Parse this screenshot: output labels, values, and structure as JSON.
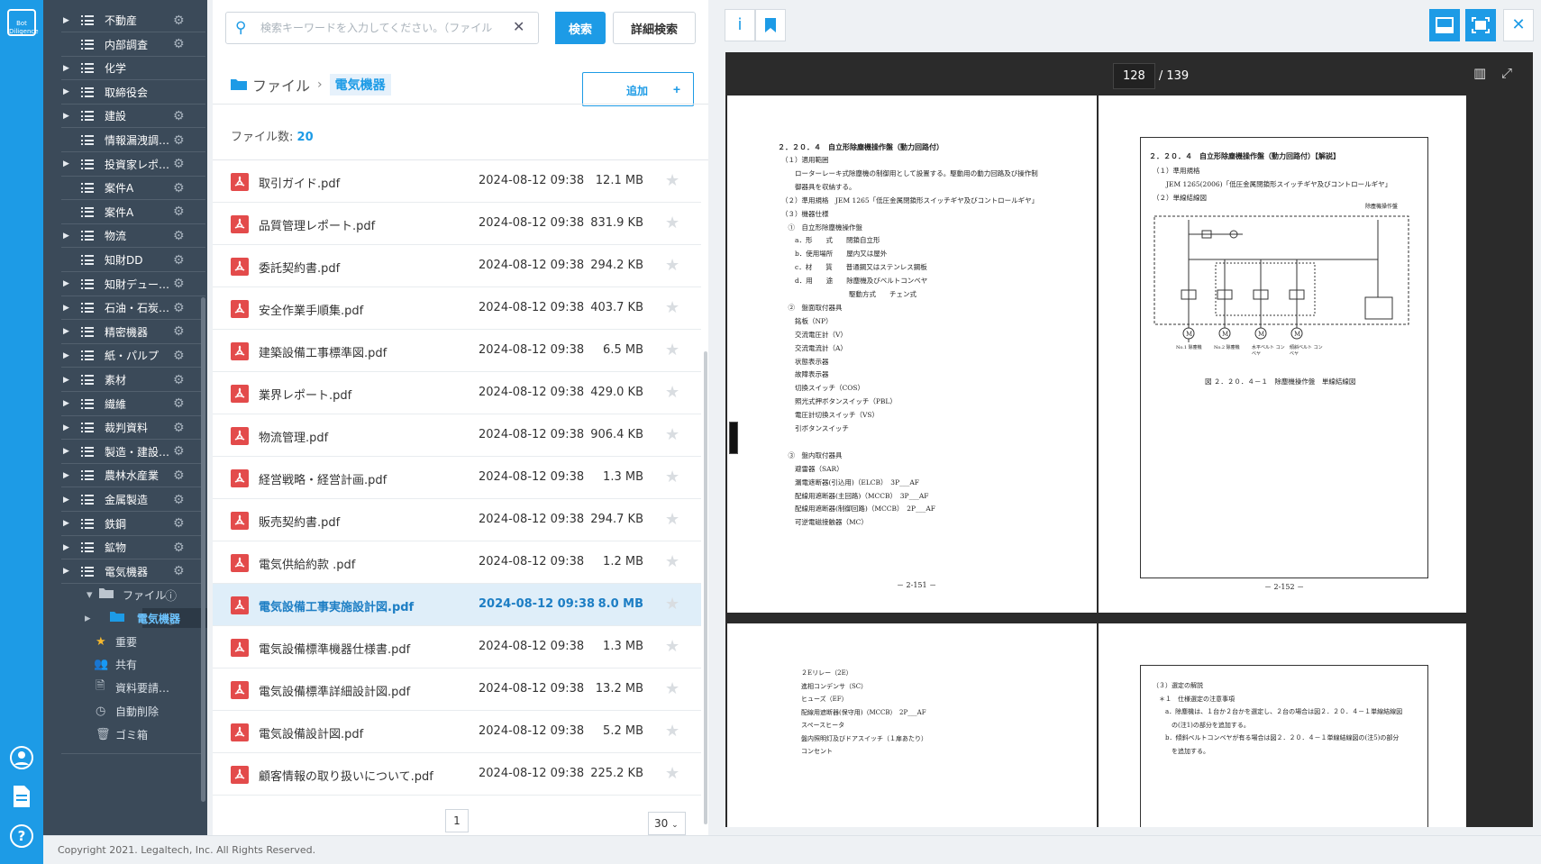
{
  "rail": {
    "logo_text": "Bot Diligence"
  },
  "sidebar": {
    "items": [
      {
        "label": "不動産",
        "caret": true,
        "gear": true
      },
      {
        "label": "内部調査",
        "caret": false,
        "gear": true
      },
      {
        "label": "化学",
        "caret": true,
        "gear": false
      },
      {
        "label": "取締役会",
        "caret": true,
        "gear": false
      },
      {
        "label": "建設",
        "caret": true,
        "gear": true
      },
      {
        "label": "情報漏洩調…",
        "caret": false,
        "gear": true
      },
      {
        "label": "投資家レポ…",
        "caret": true,
        "gear": true
      },
      {
        "label": "案件A",
        "caret": false,
        "gear": true
      },
      {
        "label": "案件A",
        "caret": false,
        "gear": true
      },
      {
        "label": "物流",
        "caret": true,
        "gear": true
      },
      {
        "label": "知財DD",
        "caret": false,
        "gear": true
      },
      {
        "label": "知財デュー…",
        "caret": true,
        "gear": true
      },
      {
        "label": "石油・石炭…",
        "caret": true,
        "gear": true
      },
      {
        "label": "精密機器",
        "caret": true,
        "gear": true
      },
      {
        "label": "紙・パルプ",
        "caret": true,
        "gear": true
      },
      {
        "label": "素材",
        "caret": true,
        "gear": true
      },
      {
        "label": "繊維",
        "caret": true,
        "gear": true
      },
      {
        "label": "裁判資料",
        "caret": true,
        "gear": true
      },
      {
        "label": "製造・建設…",
        "caret": true,
        "gear": true
      },
      {
        "label": "農林水産業",
        "caret": true,
        "gear": true
      },
      {
        "label": "金属製造",
        "caret": true,
        "gear": true
      },
      {
        "label": "鉄鋼",
        "caret": true,
        "gear": true
      },
      {
        "label": "鉱物",
        "caret": true,
        "gear": true
      },
      {
        "label": "電気機器",
        "caret": true,
        "gear": true
      }
    ],
    "sub": {
      "files": "ファイル",
      "current": "電気機器",
      "important": "重要",
      "shared": "共有",
      "request": "資料要請…",
      "auto_delete": "自動削除",
      "trash": "ゴミ箱"
    }
  },
  "search": {
    "placeholder": "検索キーワードを入力してください。（ファイル",
    "button": "検索",
    "advanced": "詳細検索"
  },
  "breadcrumb": {
    "root": "ファイル",
    "current": "電気機器"
  },
  "add_label": "追加",
  "file_count_label": "ファイル数:",
  "file_count": "20",
  "files": [
    {
      "name": "取引ガイド.pdf",
      "date": "2024-08-12 09:38",
      "size": "12.1 MB"
    },
    {
      "name": "品質管理レポート.pdf",
      "date": "2024-08-12 09:38",
      "size": "831.9 KB"
    },
    {
      "name": "委託契約書.pdf",
      "date": "2024-08-12 09:38",
      "size": "294.2 KB"
    },
    {
      "name": "安全作業手順集.pdf",
      "date": "2024-08-12 09:38",
      "size": "403.7 KB"
    },
    {
      "name": "建築設備工事標準図.pdf",
      "date": "2024-08-12 09:38",
      "size": "6.5 MB"
    },
    {
      "name": "業界レポート.pdf",
      "date": "2024-08-12 09:38",
      "size": "429.0 KB"
    },
    {
      "name": "物流管理.pdf",
      "date": "2024-08-12 09:38",
      "size": "906.4 KB"
    },
    {
      "name": "経営戦略・経営計画.pdf",
      "date": "2024-08-12 09:38",
      "size": "1.3 MB"
    },
    {
      "name": "販売契約書.pdf",
      "date": "2024-08-12 09:38",
      "size": "294.7 KB"
    },
    {
      "name": "電気供給約款 .pdf",
      "date": "2024-08-12 09:38",
      "size": "1.2 MB"
    },
    {
      "name": "電気設備工事実施設計図.pdf",
      "date": "2024-08-12 09:38",
      "size": "8.0 MB"
    },
    {
      "name": "電気設備標準機器仕様書.pdf",
      "date": "2024-08-12 09:38",
      "size": "1.3 MB"
    },
    {
      "name": "電気設備標準詳細設計図.pdf",
      "date": "2024-08-12 09:38",
      "size": "13.2 MB"
    },
    {
      "name": "電気設備設計図.pdf",
      "date": "2024-08-12 09:38",
      "size": "5.2 MB"
    },
    {
      "name": "顧客情報の取り扱いについて.pdf",
      "date": "2024-08-12 09:38",
      "size": "225.2 KB"
    }
  ],
  "selected_index": 10,
  "pagination": {
    "page": "1",
    "per_page": "30"
  },
  "viewer": {
    "current_page": "128",
    "total_pages": "/ 139",
    "left_page": {
      "heading": "２．２０．４　自立形除塵機操作盤（動力回路付）",
      "lines": [
        "（１）適用範囲",
        "　　ローターレーキ式除塵機の制御用として設置する。駆動用の動力回路及び操作制",
        "　　御器具を収納する。",
        "（２）準用規格　JEM 1265「低圧金属閉鎖形スイッチギヤ及びコントロールギヤ」",
        "（３）機器仕様",
        "　①　自立形除塵機操作盤",
        "　　a．形　　式　　閉鎖自立形",
        "　　b．使用場所　　屋内又は屋外",
        "　　c．材　　質　　普通鋼又はステンレス鋼板",
        "　　d．用　　途　　除塵機及びベルトコンベヤ",
        "　　　　　　　　　　駆動方式　　チェン式",
        "　②　盤面取付器具",
        "　　銘板（NP）",
        "　　交流電圧計（V）",
        "　　交流電流計（A）",
        "　　状態表示器",
        "　　故障表示器",
        "　　切換スイッチ（COS）",
        "　　照光式押ボタンスイッチ（PBL）",
        "　　電圧計切換スイッチ（VS）",
        "　　引ボタンスイッチ",
        "",
        "　③　盤内取付器具",
        "　　避雷器（SAR）",
        "　　漏電遮断器(引込用)（ELCB）　3P___AF",
        "　　配線用遮断器(主回路)（MCCB）　3P___AF",
        "　　配線用遮断器(制御回路)（MCCB）　2P___AF",
        "　　可逆電磁接触器（MC）"
      ],
      "footer": "－ 2-151 －"
    },
    "right_page": {
      "heading": "２．２０．４　自立形除塵機操作盤（動力回路付）【解説】",
      "lines": [
        "（１）準用規格",
        "　　JEM 1265(2006)「低圧金属閉鎖形スイッチギヤ及びコントロールギヤ」",
        "（２）単線結線図"
      ],
      "caption": "図 ２．２０．４－１　除塵機操作盤　単線結線図",
      "footer": "－ 2-152 －",
      "diagram_title": "除塵機操作盤",
      "motor_labels": [
        "No.1 除塵機",
        "No.2 除塵機",
        "水平ベルト コンベヤ",
        "傾斜ベルト コンベヤ"
      ]
    },
    "next_left": {
      "lines": [
        "２Eリレー（2E）",
        "進相コンデンサ（SC）",
        "ヒューズ（EF）",
        "配線用遮断器(保守用)（MCCB）　2P___AF",
        "スペースヒータ",
        "盤内照明灯及びドアスイッチ（１扉あたり）",
        "コンセント"
      ]
    },
    "next_right": {
      "lines": [
        "（３）選定の解説",
        "　＊１　仕様選定の注意事項",
        "　　a．除塵機は、１台か２台かを選定し、２台の場合は図２．２０．４－１単線結線図",
        "　　　の(注1)の部分を追加する。",
        "　　b．傾斜ベルトコンベヤが有る場合は図２．２０．４－１単線結線図の(注5)の部分",
        "　　　を追加する。"
      ]
    }
  },
  "footer": "Copyright 2021. Legaltech, Inc. All Rights Reserved.",
  "colors": {
    "accent": "#1d9be6",
    "sidebar": "#3b4a59"
  }
}
